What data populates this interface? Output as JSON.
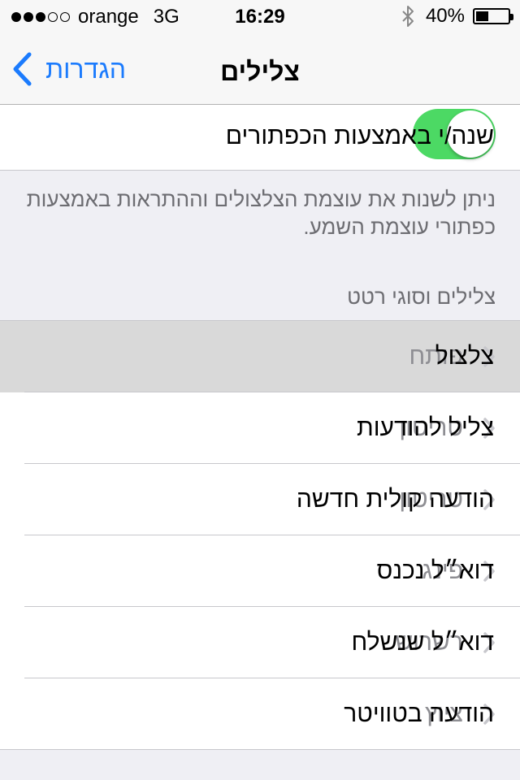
{
  "status_bar": {
    "signal_bars_filled": 3,
    "signal_bars_total": 5,
    "carrier": "orange",
    "network": "3G",
    "time": "16:29",
    "battery_text": "40%",
    "battery_level": 0.4
  },
  "nav": {
    "back_label": "הגדרות",
    "title": "צלילים"
  },
  "toggle_row": {
    "label": "שנה/י באמצעות הכפתורים",
    "on": true,
    "color": "#4cd964"
  },
  "footer_text": "ניתן לשנות את עוצמת הצלצולים וההתראות באמצעות כפתורי עוצמת השמע.",
  "section_header": "צלילים וסוגי רטט",
  "items": [
    {
      "label": "צלצול",
      "value": "פותח",
      "selected": true
    },
    {
      "label": "צליל להודעות",
      "value": "טריטון"
    },
    {
      "label": "הודעה קולית חדשה",
      "value": "טריטון"
    },
    {
      "label": "דוא״ל נכנס",
      "value": "פינג"
    },
    {
      "label": "דוא״ל שנשלח",
      "value": "רשרוש"
    },
    {
      "label": "הודעה בטוויטר",
      "value": "ציוץ"
    }
  ],
  "accent_color": "#1b7bfd"
}
